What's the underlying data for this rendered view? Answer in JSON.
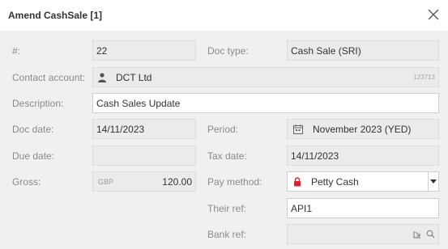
{
  "dialog": {
    "title": "Amend CashSale [1]"
  },
  "labels": {
    "number": "#:",
    "doc_type": "Doc type:",
    "contact_account": "Contact account:",
    "description": "Description:",
    "doc_date": "Doc date:",
    "period": "Period:",
    "due_date": "Due date:",
    "tax_date": "Tax date:",
    "gross": "Gross:",
    "pay_method": "Pay method:",
    "their_ref": "Their ref:",
    "bank_ref": "Bank ref:"
  },
  "values": {
    "number": "22",
    "doc_type": "Cash Sale (SRI)",
    "contact_account_name": "DCT Ltd",
    "contact_account_code": "123713",
    "description": "Cash Sales Update",
    "doc_date": "14/11/2023",
    "period": "November 2023 (YED)",
    "due_date": "",
    "tax_date": "14/11/2023",
    "gross_currency": "GBP",
    "gross_amount": "120.00",
    "pay_method": "Petty Cash",
    "their_ref": "API1",
    "bank_ref": ""
  },
  "icons": {
    "close": "close-icon",
    "contact": "person-icon",
    "period": "calendar-icon",
    "pay_method": "lock-icon",
    "bank_ref_pick": "pick-icon",
    "bank_ref_search": "search-icon",
    "dropdown": "caret-down-icon"
  },
  "colors": {
    "lock": "#e0202a",
    "header_bg": "#ffffff",
    "body_bg": "#f0f0f0"
  }
}
